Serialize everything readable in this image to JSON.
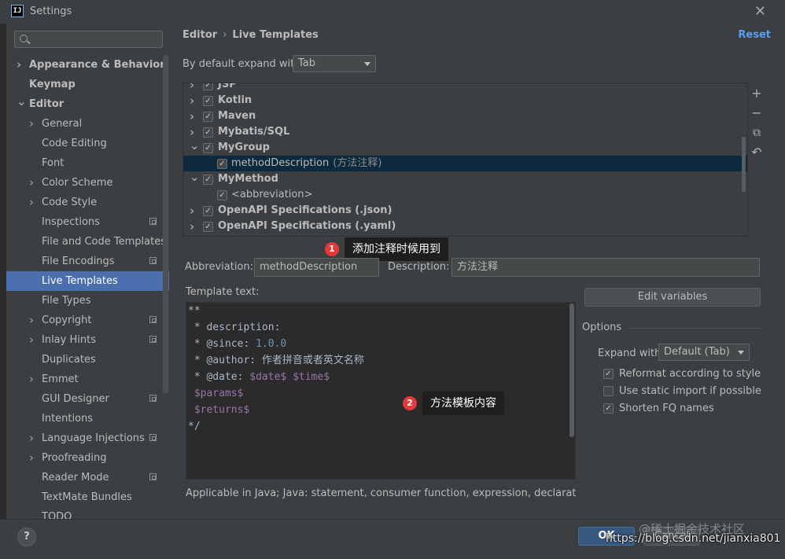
{
  "window": {
    "title": "Settings",
    "logo": "IJ"
  },
  "sidebar": {
    "items": [
      {
        "label": "Appearance & Behavior",
        "level": 0,
        "arrow": ">"
      },
      {
        "label": "Keymap",
        "level": 0,
        "arrow": ""
      },
      {
        "label": "Editor",
        "level": 0,
        "arrow": "v"
      },
      {
        "label": "General",
        "level": 1,
        "arrow": ">"
      },
      {
        "label": "Code Editing",
        "level": 1,
        "arrow": ""
      },
      {
        "label": "Font",
        "level": 1,
        "arrow": ""
      },
      {
        "label": "Color Scheme",
        "level": 1,
        "arrow": ">"
      },
      {
        "label": "Code Style",
        "level": 1,
        "arrow": ">"
      },
      {
        "label": "Inspections",
        "level": 1,
        "arrow": "",
        "project_icon": true
      },
      {
        "label": "File and Code Templates",
        "level": 1,
        "arrow": ""
      },
      {
        "label": "File Encodings",
        "level": 1,
        "arrow": "",
        "project_icon": true
      },
      {
        "label": "Live Templates",
        "level": 1,
        "arrow": "",
        "selected": true
      },
      {
        "label": "File Types",
        "level": 1,
        "arrow": ""
      },
      {
        "label": "Copyright",
        "level": 1,
        "arrow": ">",
        "project_icon": true
      },
      {
        "label": "Inlay Hints",
        "level": 1,
        "arrow": ">",
        "project_icon": true
      },
      {
        "label": "Duplicates",
        "level": 1,
        "arrow": ""
      },
      {
        "label": "Emmet",
        "level": 1,
        "arrow": ">"
      },
      {
        "label": "GUI Designer",
        "level": 1,
        "arrow": "",
        "project_icon": true
      },
      {
        "label": "Intentions",
        "level": 1,
        "arrow": ""
      },
      {
        "label": "Language Injections",
        "level": 1,
        "arrow": ">",
        "project_icon": true
      },
      {
        "label": "Proofreading",
        "level": 1,
        "arrow": ">"
      },
      {
        "label": "Reader Mode",
        "level": 1,
        "arrow": "",
        "project_icon": true
      },
      {
        "label": "TextMate Bundles",
        "level": 1,
        "arrow": ""
      },
      {
        "label": "TODO",
        "level": 1,
        "arrow": ""
      }
    ]
  },
  "header": {
    "breadcrumb": [
      "Editor",
      "Live Templates"
    ],
    "breadcrumb_sep": "›",
    "reset": "Reset",
    "expand_label": "By default expand with",
    "expand_value": "Tab"
  },
  "templates": {
    "rows": [
      {
        "label": "JSP",
        "type": "group",
        "arrow": ">",
        "checked": true
      },
      {
        "label": "Kotlin",
        "type": "group",
        "arrow": ">",
        "checked": true
      },
      {
        "label": "Maven",
        "type": "group",
        "arrow": ">",
        "checked": true
      },
      {
        "label": "Mybatis/SQL",
        "type": "group",
        "arrow": ">",
        "checked": true
      },
      {
        "label": "MyGroup",
        "type": "group",
        "arrow": "v",
        "checked": true
      },
      {
        "label": "methodDescription",
        "hint": "(方法注释)",
        "type": "item",
        "checked": true,
        "selected": true
      },
      {
        "label": "MyMethod",
        "type": "group",
        "arrow": "v",
        "checked": true
      },
      {
        "label": "<abbreviation>",
        "type": "item",
        "checked": true
      },
      {
        "label": "OpenAPI Specifications (.json)",
        "type": "group",
        "arrow": ">",
        "checked": true
      },
      {
        "label": "OpenAPI Specifications (.yaml)",
        "type": "group",
        "arrow": ">",
        "checked": true
      }
    ],
    "tools": [
      "+",
      "−",
      "⧉",
      "↶"
    ]
  },
  "callouts": [
    {
      "num": "1",
      "text": "添加注释时候用到"
    },
    {
      "num": "2",
      "text": "方法模板内容"
    }
  ],
  "form": {
    "abbreviation_label": "Abbreviation:",
    "abbreviation_value": "methodDescription",
    "description_label": "Description:",
    "description_value": "方法注释",
    "template_text_label": "Template text:"
  },
  "code": {
    "l1": "**",
    "l2": " * description:",
    "l3a": " * @since: ",
    "l3b": "1.0.0",
    "l4a": " * @author: ",
    "l4b": "作者拼音或者英文名称",
    "l5a": " * @date: ",
    "l5b": "$date$",
    "l5c": " ",
    "l5d": "$time$",
    "l6": " $params$",
    "l7": " $returns$",
    "l8": "*/"
  },
  "options": {
    "edit_variables": "Edit variables",
    "title": "Options",
    "expand_with_label": "Expand with",
    "expand_with_value": "Default (Tab)",
    "reformat": {
      "label": "Reformat according to style",
      "checked": true
    },
    "static_import": {
      "label": "Use static import if possible",
      "checked": false
    },
    "shorten_fq": {
      "label": "Shorten FQ names",
      "checked": true
    }
  },
  "applicable": "Applicable in Java; Java: statement, consumer function, expression, declaration, comm",
  "footer": {
    "help": "?",
    "ok": "OK",
    "cancel": "Cancel",
    "watermark": "https://blog.csdn.net/jianxia801",
    "watermark2": "@稀土掘金技术社区"
  },
  "colors": {
    "accent": "#4b6eaf",
    "link": "#589df6",
    "badge": "#e5383b",
    "ok": "#365880"
  }
}
